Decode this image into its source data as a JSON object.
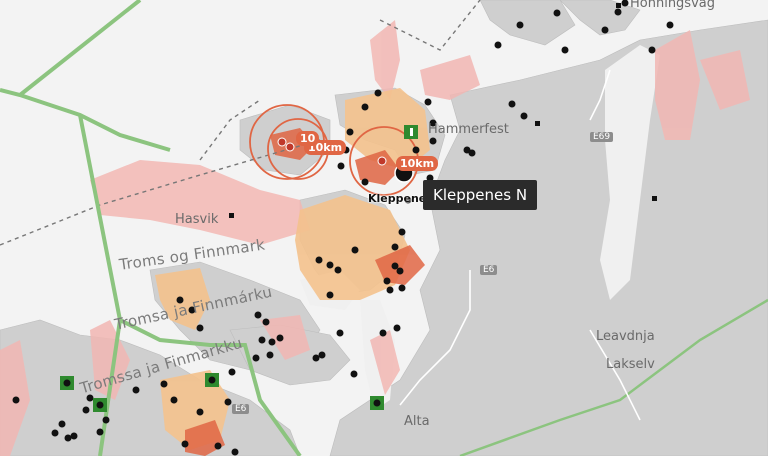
{
  "place_labels": {
    "hammerfest": "Hammerfest",
    "hasvik": "Hasvik",
    "alta": "Alta",
    "leavdnja": "Leavdnja",
    "lakselv": "Lakselv",
    "honningsvag": "Honningsvåg"
  },
  "region_labels": {
    "region_a": "Troms og Finnmark",
    "region_b": "Tromsa ja Finnmárku",
    "region_c": "Tromssa ja Finmarkku"
  },
  "road_labels": {
    "e69": "E69",
    "e6_a": "E6",
    "e6_b": "E6"
  },
  "distance_badges": {
    "badge_a": "10km",
    "badge_b": "10km",
    "badge_c": "10"
  },
  "selected_marker": {
    "label": "Kleppenes N",
    "tooltip": "Kleppenes N"
  },
  "colors": {
    "land": "#c9c9c9",
    "water": "#f4f4f4",
    "border": "#8cc47f",
    "restriction_pink": "#f2b7b3",
    "restriction_orange": "#f4c28d",
    "cluster": "#e06644",
    "marker": "#111111",
    "station_green": "#2f8a2f"
  }
}
